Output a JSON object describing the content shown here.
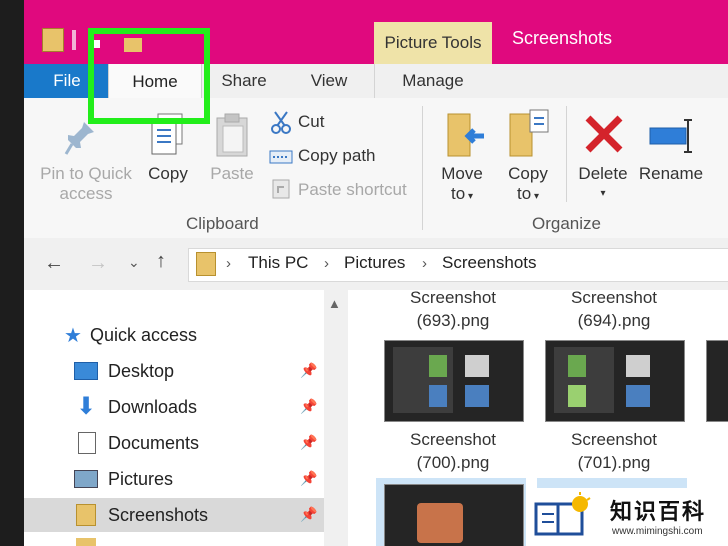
{
  "window": {
    "title": "Screenshots",
    "context_group": "Picture Tools"
  },
  "tabs": {
    "file": "File",
    "home": "Home",
    "share": "Share",
    "view": "View",
    "manage": "Manage"
  },
  "ribbon": {
    "clipboard": {
      "pin_line1": "Pin to Quick",
      "pin_line2": "access",
      "copy": "Copy",
      "paste": "Paste",
      "cut": "Cut",
      "copy_path": "Copy path",
      "paste_shortcut": "Paste shortcut",
      "group": "Clipboard"
    },
    "organize": {
      "move_line1": "Move",
      "move_line2": "to",
      "copy_line1": "Copy",
      "copy_line2": "to",
      "delete": "Delete",
      "rename": "Rename",
      "group": "Organize"
    }
  },
  "address": {
    "segments": [
      "This PC",
      "Pictures",
      "Screenshots"
    ]
  },
  "nav": {
    "quick_access": "Quick access",
    "items": [
      {
        "label": "Desktop",
        "icon": "desktop-icon"
      },
      {
        "label": "Downloads",
        "icon": "downloads-icon"
      },
      {
        "label": "Documents",
        "icon": "documents-icon"
      },
      {
        "label": "Pictures",
        "icon": "pictures-icon"
      },
      {
        "label": "Screenshots",
        "icon": "folder-icon",
        "selected": true
      }
    ]
  },
  "files": [
    {
      "line1": "Screenshot",
      "line2": "(693).png"
    },
    {
      "line1": "Screenshot",
      "line2": "(694).png"
    },
    {
      "line1": "Screenshot",
      "line2": "(700).png"
    },
    {
      "line1": "Screenshot",
      "line2": "(701).png"
    }
  ],
  "watermark": {
    "title": "知识百科",
    "url": "www.mimingshi.com"
  },
  "colors": {
    "accent_title": "#e0097e",
    "file_tab": "#1979ca",
    "highlight": "#22ee1a",
    "context_group": "#efe3a8"
  }
}
